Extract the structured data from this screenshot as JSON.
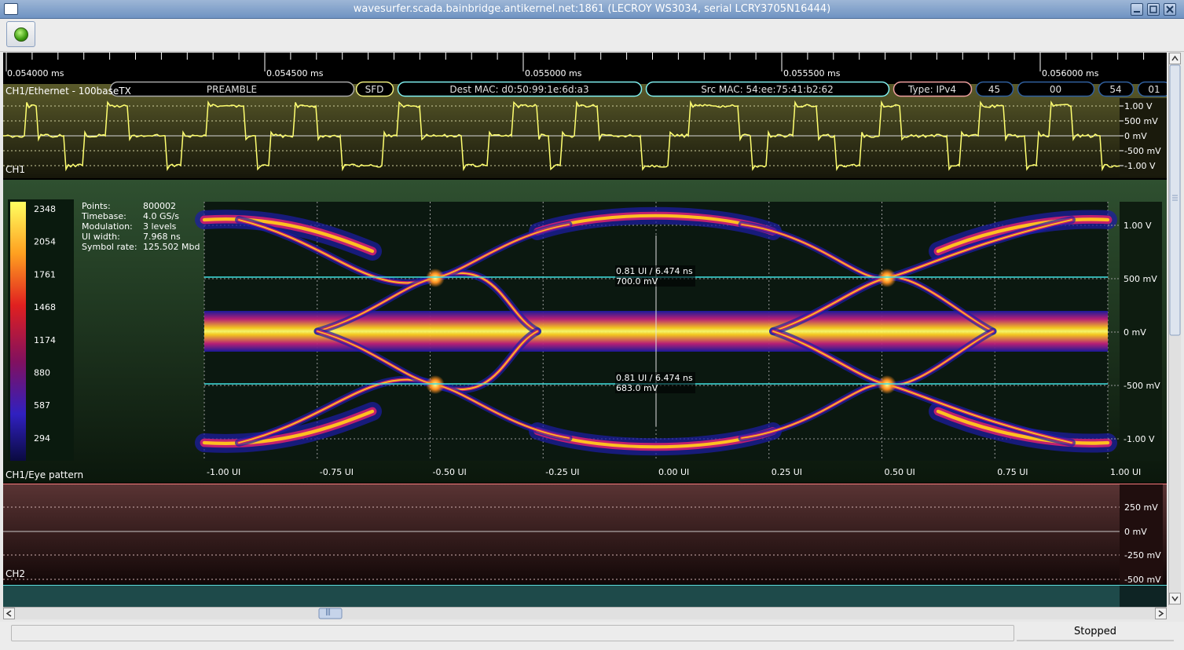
{
  "window": {
    "title": "wavesurfer.scada.bainbridge.antikernel.net:1861 (LECROY WS3034, serial LCRY3705N16444)"
  },
  "timeline": {
    "labels": [
      "0.054000 ms",
      "0.054500 ms",
      "0.055000 ms",
      "0.055500 ms",
      "0.056000 ms"
    ]
  },
  "ch1": {
    "decode_name": "CH1/Ethernet - 100baseTX",
    "name": "CH1",
    "protocol_fields": [
      {
        "label": "PREAMBLE",
        "color": "#a8a8a8"
      },
      {
        "label": "SFD",
        "color": "#f0f080"
      },
      {
        "label": "Dest MAC: d0:50:99:1e:6d:a3",
        "color": "#80f0f0"
      },
      {
        "label": "Src MAC: 54:ee:75:41:b2:62",
        "color": "#80f0f0"
      },
      {
        "label": "Type: IPv4",
        "color": "#f0a0a0"
      },
      {
        "label": "45",
        "color": "#3060a0"
      },
      {
        "label": "00",
        "color": "#3060a0"
      },
      {
        "label": "54",
        "color": "#3060a0"
      },
      {
        "label": "01",
        "color": "#3060a0"
      }
    ],
    "y_labels": [
      "1.00 V",
      "500 mV",
      "0 mV",
      "-500 mV",
      "-1.00 V"
    ],
    "trace_color": "#ffff70"
  },
  "eye": {
    "name": "CH1/Eye pattern",
    "color_scale": [
      "2348",
      "2054",
      "1761",
      "1468",
      "1174",
      "880",
      "587",
      "294"
    ],
    "info": [
      {
        "k": "Points:",
        "v": "800002"
      },
      {
        "k": "Timebase:",
        "v": "4.0 GS/s"
      },
      {
        "k": "Modulation:",
        "v": "3 levels"
      },
      {
        "k": "UI width:",
        "v": "7.968 ns"
      },
      {
        "k": "Symbol rate:",
        "v": "125.502 Mbd"
      }
    ],
    "y_labels": [
      "1.00 V",
      "500 mV",
      "0 mV",
      "-500 mV",
      "-1.00 V"
    ],
    "x_labels": [
      "-1.00 UI",
      "-0.75 UI",
      "-0.50 UI",
      "-0.25 UI",
      "0.00 UI",
      "0.25 UI",
      "0.50 UI",
      "0.75 UI",
      "1.00 UI"
    ],
    "measurements": [
      {
        "line1": "0.81 UI / 6.474 ns",
        "line2": "700.0 mV"
      },
      {
        "line1": "0.81 UI / 6.474 ns",
        "line2": "683.0 mV"
      }
    ]
  },
  "ch2": {
    "name": "CH2",
    "y_labels": [
      "250 mV",
      "0 mV",
      "-250 mV",
      "-500 mV"
    ]
  },
  "scrollbar": {
    "grip": "|||"
  },
  "status": {
    "state": "Stopped"
  }
}
